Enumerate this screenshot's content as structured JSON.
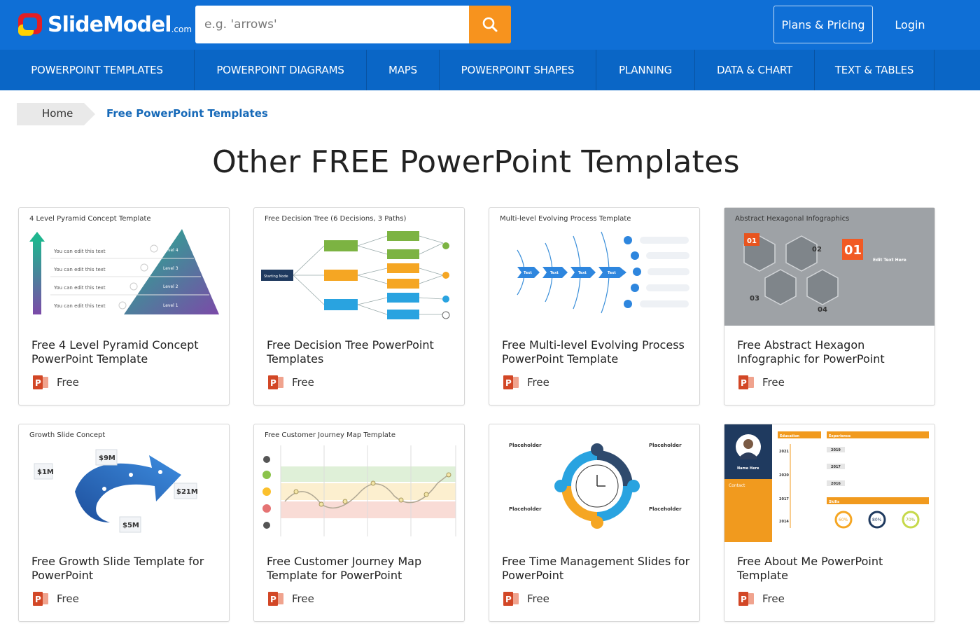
{
  "header": {
    "logo_text": "SlideModel",
    "logo_suffix": ".com",
    "search_placeholder": "e.g. 'arrows'",
    "search_icon": "search-icon",
    "plans_label": "Plans & Pricing",
    "login_label": "Login"
  },
  "nav": {
    "items": [
      {
        "label": "POWERPOINT TEMPLATES"
      },
      {
        "label": "POWERPOINT DIAGRAMS"
      },
      {
        "label": "MAPS"
      },
      {
        "label": "POWERPOINT SHAPES"
      },
      {
        "label": "PLANNING"
      },
      {
        "label": "DATA & CHART"
      },
      {
        "label": "TEXT & TABLES"
      }
    ]
  },
  "breadcrumb": {
    "home": "Home",
    "current": "Free PowerPoint Templates"
  },
  "page_title": "Other FREE PowerPoint Templates",
  "cards": [
    {
      "thumb_label": "4 Level Pyramid Concept Template",
      "title": "Free 4 Level Pyramid Concept PowerPoint Template",
      "badge": "Free"
    },
    {
      "thumb_label": "Free Decision Tree (6 Decisions, 3 Paths)",
      "title": "Free Decision Tree PowerPoint Templates",
      "badge": "Free"
    },
    {
      "thumb_label": "Multi-level Evolving Process Template",
      "title": "Free Multi-level Evolving Process PowerPoint Template",
      "badge": "Free"
    },
    {
      "thumb_label": "Abstract Hexagonal Infographics",
      "title": "Free Abstract Hexagon Infographic for PowerPoint",
      "badge": "Free"
    },
    {
      "thumb_label": "Growth Slide Concept",
      "title": "Free Growth Slide Template for PowerPoint",
      "badge": "Free"
    },
    {
      "thumb_label": "Free Customer Journey Map Template",
      "title": "Free Customer Journey Map Template for PowerPoint",
      "badge": "Free"
    },
    {
      "thumb_label": "",
      "title": "Free Time Management Slides for PowerPoint",
      "badge": "Free"
    },
    {
      "thumb_label": "",
      "title": "Free About Me PowerPoint Template",
      "badge": "Free"
    }
  ],
  "thumb_text": {
    "pyramid_row": "You can edit this text",
    "pyramid_levels": [
      "Level 4",
      "Level 3",
      "Level 2",
      "Level 1"
    ],
    "tree_start": "Starting Node",
    "hex_big": "01",
    "hex_nums": [
      "01",
      "02",
      "03",
      "04"
    ],
    "hex_edit": "Edit Text Here",
    "growth_values": [
      "$1M",
      "$9M",
      "$21M",
      "$5M"
    ],
    "process_tag": "Text",
    "placeholder": "Placeholder",
    "about_name": "Name Here",
    "about_contact": "Contact",
    "about_education": "Education",
    "about_experience": "Experience",
    "about_skills": "Skills",
    "about_years": [
      "2021",
      "2020",
      "2017",
      "2014"
    ],
    "about_exp_years": [
      "2019",
      "2017",
      "2016"
    ],
    "about_pcts": [
      "60%",
      "80%",
      "70%"
    ]
  },
  "colors": {
    "header_blue": "#0f6fd6",
    "nav_blue": "#0a66c6",
    "search_orange": "#f7931e",
    "link_blue": "#1669b8",
    "ppt_red": "#d24726"
  }
}
